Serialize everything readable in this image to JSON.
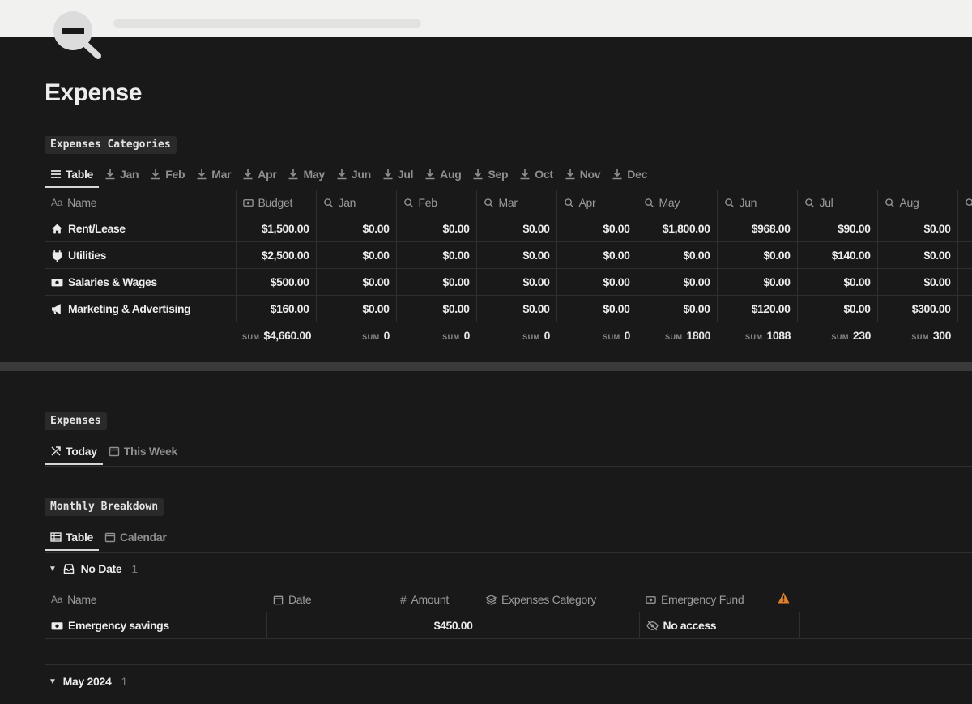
{
  "page": {
    "title": "Expense"
  },
  "categories_db": {
    "tag": "Expenses Categories",
    "views": [
      {
        "label": "Table",
        "icon": "table-list-icon",
        "active": true
      },
      {
        "label": "Jan",
        "icon": "download-icon"
      },
      {
        "label": "Feb",
        "icon": "download-icon"
      },
      {
        "label": "Mar",
        "icon": "download-icon"
      },
      {
        "label": "Apr",
        "icon": "download-icon"
      },
      {
        "label": "May",
        "icon": "download-icon"
      },
      {
        "label": "Jun",
        "icon": "download-icon"
      },
      {
        "label": "Jul",
        "icon": "download-icon"
      },
      {
        "label": "Aug",
        "icon": "download-icon"
      },
      {
        "label": "Sep",
        "icon": "download-icon"
      },
      {
        "label": "Oct",
        "icon": "download-icon"
      },
      {
        "label": "Nov",
        "icon": "download-icon"
      },
      {
        "label": "Dec",
        "icon": "download-icon"
      }
    ],
    "columns": [
      {
        "label": "Name",
        "icon": "text-property-icon"
      },
      {
        "label": "Budget",
        "icon": "money-icon"
      },
      {
        "label": "Jan",
        "icon": "search-icon"
      },
      {
        "label": "Feb",
        "icon": "search-icon"
      },
      {
        "label": "Mar",
        "icon": "search-icon"
      },
      {
        "label": "Apr",
        "icon": "search-icon"
      },
      {
        "label": "May",
        "icon": "search-icon"
      },
      {
        "label": "Jun",
        "icon": "search-icon"
      },
      {
        "label": "Jul",
        "icon": "search-icon"
      },
      {
        "label": "Aug",
        "icon": "search-icon"
      }
    ],
    "rows": [
      {
        "name": "Rent/Lease",
        "icon": "house-icon",
        "cells": [
          "$1,500.00",
          "$0.00",
          "$0.00",
          "$0.00",
          "$0.00",
          "$1,800.00",
          "$968.00",
          "$90.00",
          "$0.00"
        ]
      },
      {
        "name": "Utilities",
        "icon": "plug-icon",
        "cells": [
          "$2,500.00",
          "$0.00",
          "$0.00",
          "$0.00",
          "$0.00",
          "$0.00",
          "$0.00",
          "$140.00",
          "$0.00"
        ]
      },
      {
        "name": "Salaries & Wages",
        "icon": "money-icon",
        "cells": [
          "$500.00",
          "$0.00",
          "$0.00",
          "$0.00",
          "$0.00",
          "$0.00",
          "$0.00",
          "$0.00",
          "$0.00"
        ]
      },
      {
        "name": "Marketing & Advertising",
        "icon": "megaphone-icon",
        "cells": [
          "$160.00",
          "$0.00",
          "$0.00",
          "$0.00",
          "$0.00",
          "$0.00",
          "$120.00",
          "$0.00",
          "$300.00"
        ]
      }
    ],
    "sum_label": "SUM",
    "sums": [
      "$4,660.00",
      "0",
      "0",
      "0",
      "0",
      "1800",
      "1088",
      "230",
      "300"
    ]
  },
  "expenses_db": {
    "tag": "Expenses",
    "views": [
      {
        "label": "Today",
        "icon": "arrows-icon",
        "active": true
      },
      {
        "label": "This Week",
        "icon": "calendar-icon"
      }
    ]
  },
  "monthly_db": {
    "tag": "Monthly Breakdown",
    "views": [
      {
        "label": "Table",
        "icon": "table-icon",
        "active": true
      },
      {
        "label": "Calendar",
        "icon": "calendar-icon"
      }
    ],
    "groups": [
      {
        "label": "No Date",
        "count": "1",
        "icon": "inbox-icon"
      },
      {
        "label": "May 2024",
        "count": "1"
      }
    ],
    "columns": [
      {
        "label": "Name",
        "icon": "text-property-icon"
      },
      {
        "label": "Date",
        "icon": "calendar-icon"
      },
      {
        "label": "Amount",
        "icon": "hash-icon"
      },
      {
        "label": "Expenses Category",
        "icon": "relation-icon"
      },
      {
        "label": "Emergency Fund",
        "icon": "money-icon"
      }
    ],
    "rows": [
      {
        "name": "Emergency savings",
        "icon": "money-icon",
        "date": "",
        "amount": "$450.00",
        "category": "",
        "fund": "No access"
      }
    ]
  },
  "colors": {
    "background": "#191919",
    "text": "#ececec",
    "muted": "#9b9b9b",
    "warning": "#e0802a"
  }
}
